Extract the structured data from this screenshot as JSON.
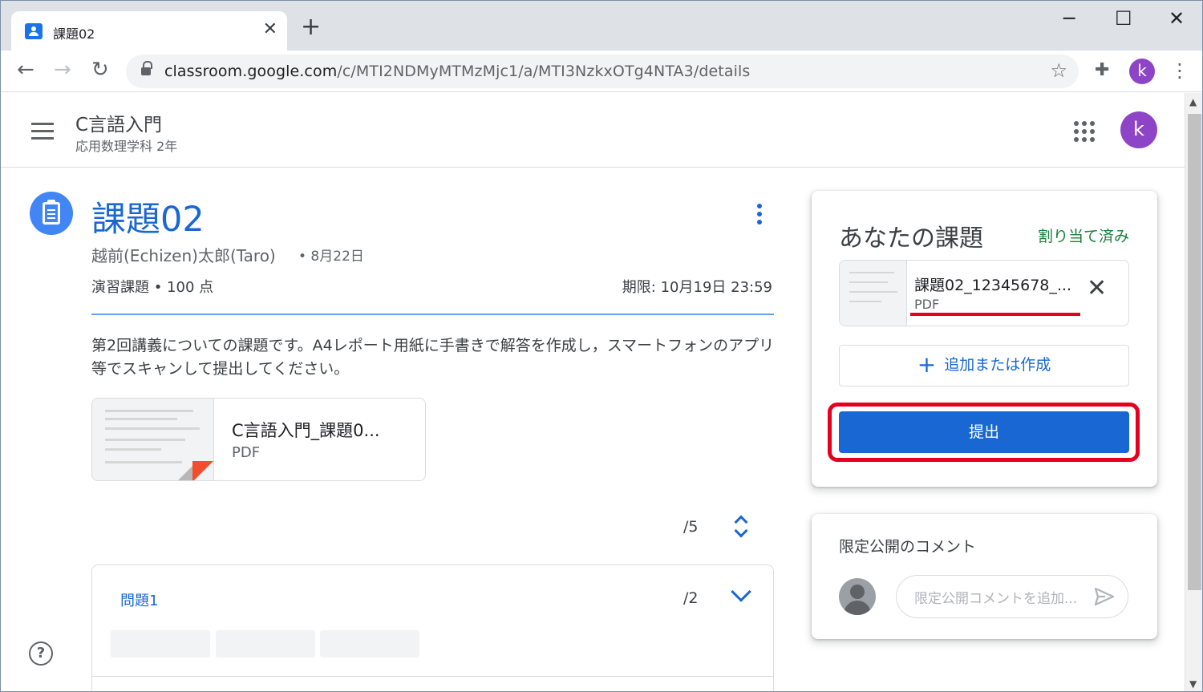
{
  "browser": {
    "tab_title": "課題02",
    "tab_close": "✕",
    "new_tab": "+",
    "minimize": "─",
    "maximize": "☐",
    "close": "✕",
    "back": "←",
    "forward": "→",
    "reload": "↻",
    "url_host": "classroom.google.com",
    "url_path": "/c/MTI2NDMyMTMzMjc1/a/MTI3NzkxOTg4NTA3/details",
    "star": "☆",
    "extensions": "✚",
    "profile_initial": "k",
    "menu": "⋮"
  },
  "header": {
    "class_name": "C言語入門",
    "class_section": "応用数理学科 2年",
    "avatar_initial": "k"
  },
  "assignment": {
    "title": "課題02",
    "author": "越前(Echizen)太郎(Taro)",
    "posted": "• 8月22日",
    "points": "演習課題 • 100 点",
    "due": "期限: 10月19日 23:59",
    "description": "第2回講義についての課題です。A4レポート用紙に手書きで解答を作成し，スマートフォンのアプリ等でスキャンして提出してください。",
    "attachment_name": "C言語入門_課題0...",
    "attachment_type": "PDF",
    "score_total": "/5",
    "question_label": "問題1",
    "question_score": "/2",
    "help": "?"
  },
  "your_work": {
    "title": "あなたの課題",
    "status": "割り当て済み",
    "file_name": "課題02_12345678_...",
    "file_type": "PDF",
    "remove": "✕",
    "add_plus": "+",
    "add_label": "追加または作成",
    "submit_label": "提出"
  },
  "private_comments": {
    "title": "限定公開のコメント",
    "placeholder": "限定公開コメントを追加..."
  },
  "colors": {
    "accent": "#1967d2",
    "status_green": "#188038",
    "highlight_red": "#e6001f",
    "avatar_purple": "#8e44c6"
  }
}
